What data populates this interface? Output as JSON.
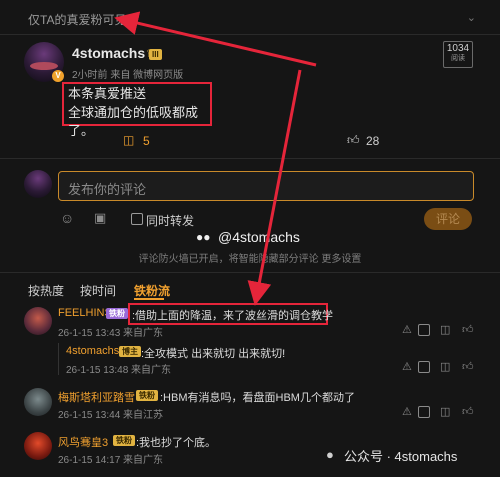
{
  "visibility_label": "仅TA的真爱粉可见",
  "post": {
    "author": "4stomachs",
    "level_badge": "III",
    "meta": "2小时前 来自 微博网页版",
    "views_count": "1034",
    "views_label": "阅读",
    "text_line1": "本条真爱推送",
    "text_line2": "全球通加仓的低吸都成了。",
    "comment_count": "5",
    "like_count": "28"
  },
  "composer": {
    "placeholder": "发布你的评论",
    "repost_label": "同时转发",
    "submit_label": "评论"
  },
  "watermark_center": "@4stomachs",
  "notice": "评论防火墙已开启，将智能隐藏部分评论 更多设置",
  "sort_tabs": [
    "按热度",
    "按时间",
    "铁粉流"
  ],
  "comments": [
    {
      "name": "FEELHINS",
      "badge": "铁粉",
      "text": ":借助上面的降温，来了波丝滑的调仓教学",
      "time": "26-1-15 13:43 来自广东"
    },
    {
      "name": "4stomachs",
      "badge": "博主",
      "text": ":全攻模式 出来就切 出来就切!",
      "time": "26-1-15 13:48 来自广东",
      "reply": true
    },
    {
      "name": "梅斯塔利亚踏雪",
      "badge": "铁粉",
      "text": ":HBM有消息吗，看盘面HBM几个都动了",
      "time": "26-1-15 13:44 来自江苏"
    },
    {
      "name": "风鸟骞皇3",
      "badge": "铁粉",
      "text": ":我也抄了个底。",
      "time": "26-1-15 14:17 来自广东"
    }
  ],
  "footer_watermark": "公众号 · 4stomachs"
}
